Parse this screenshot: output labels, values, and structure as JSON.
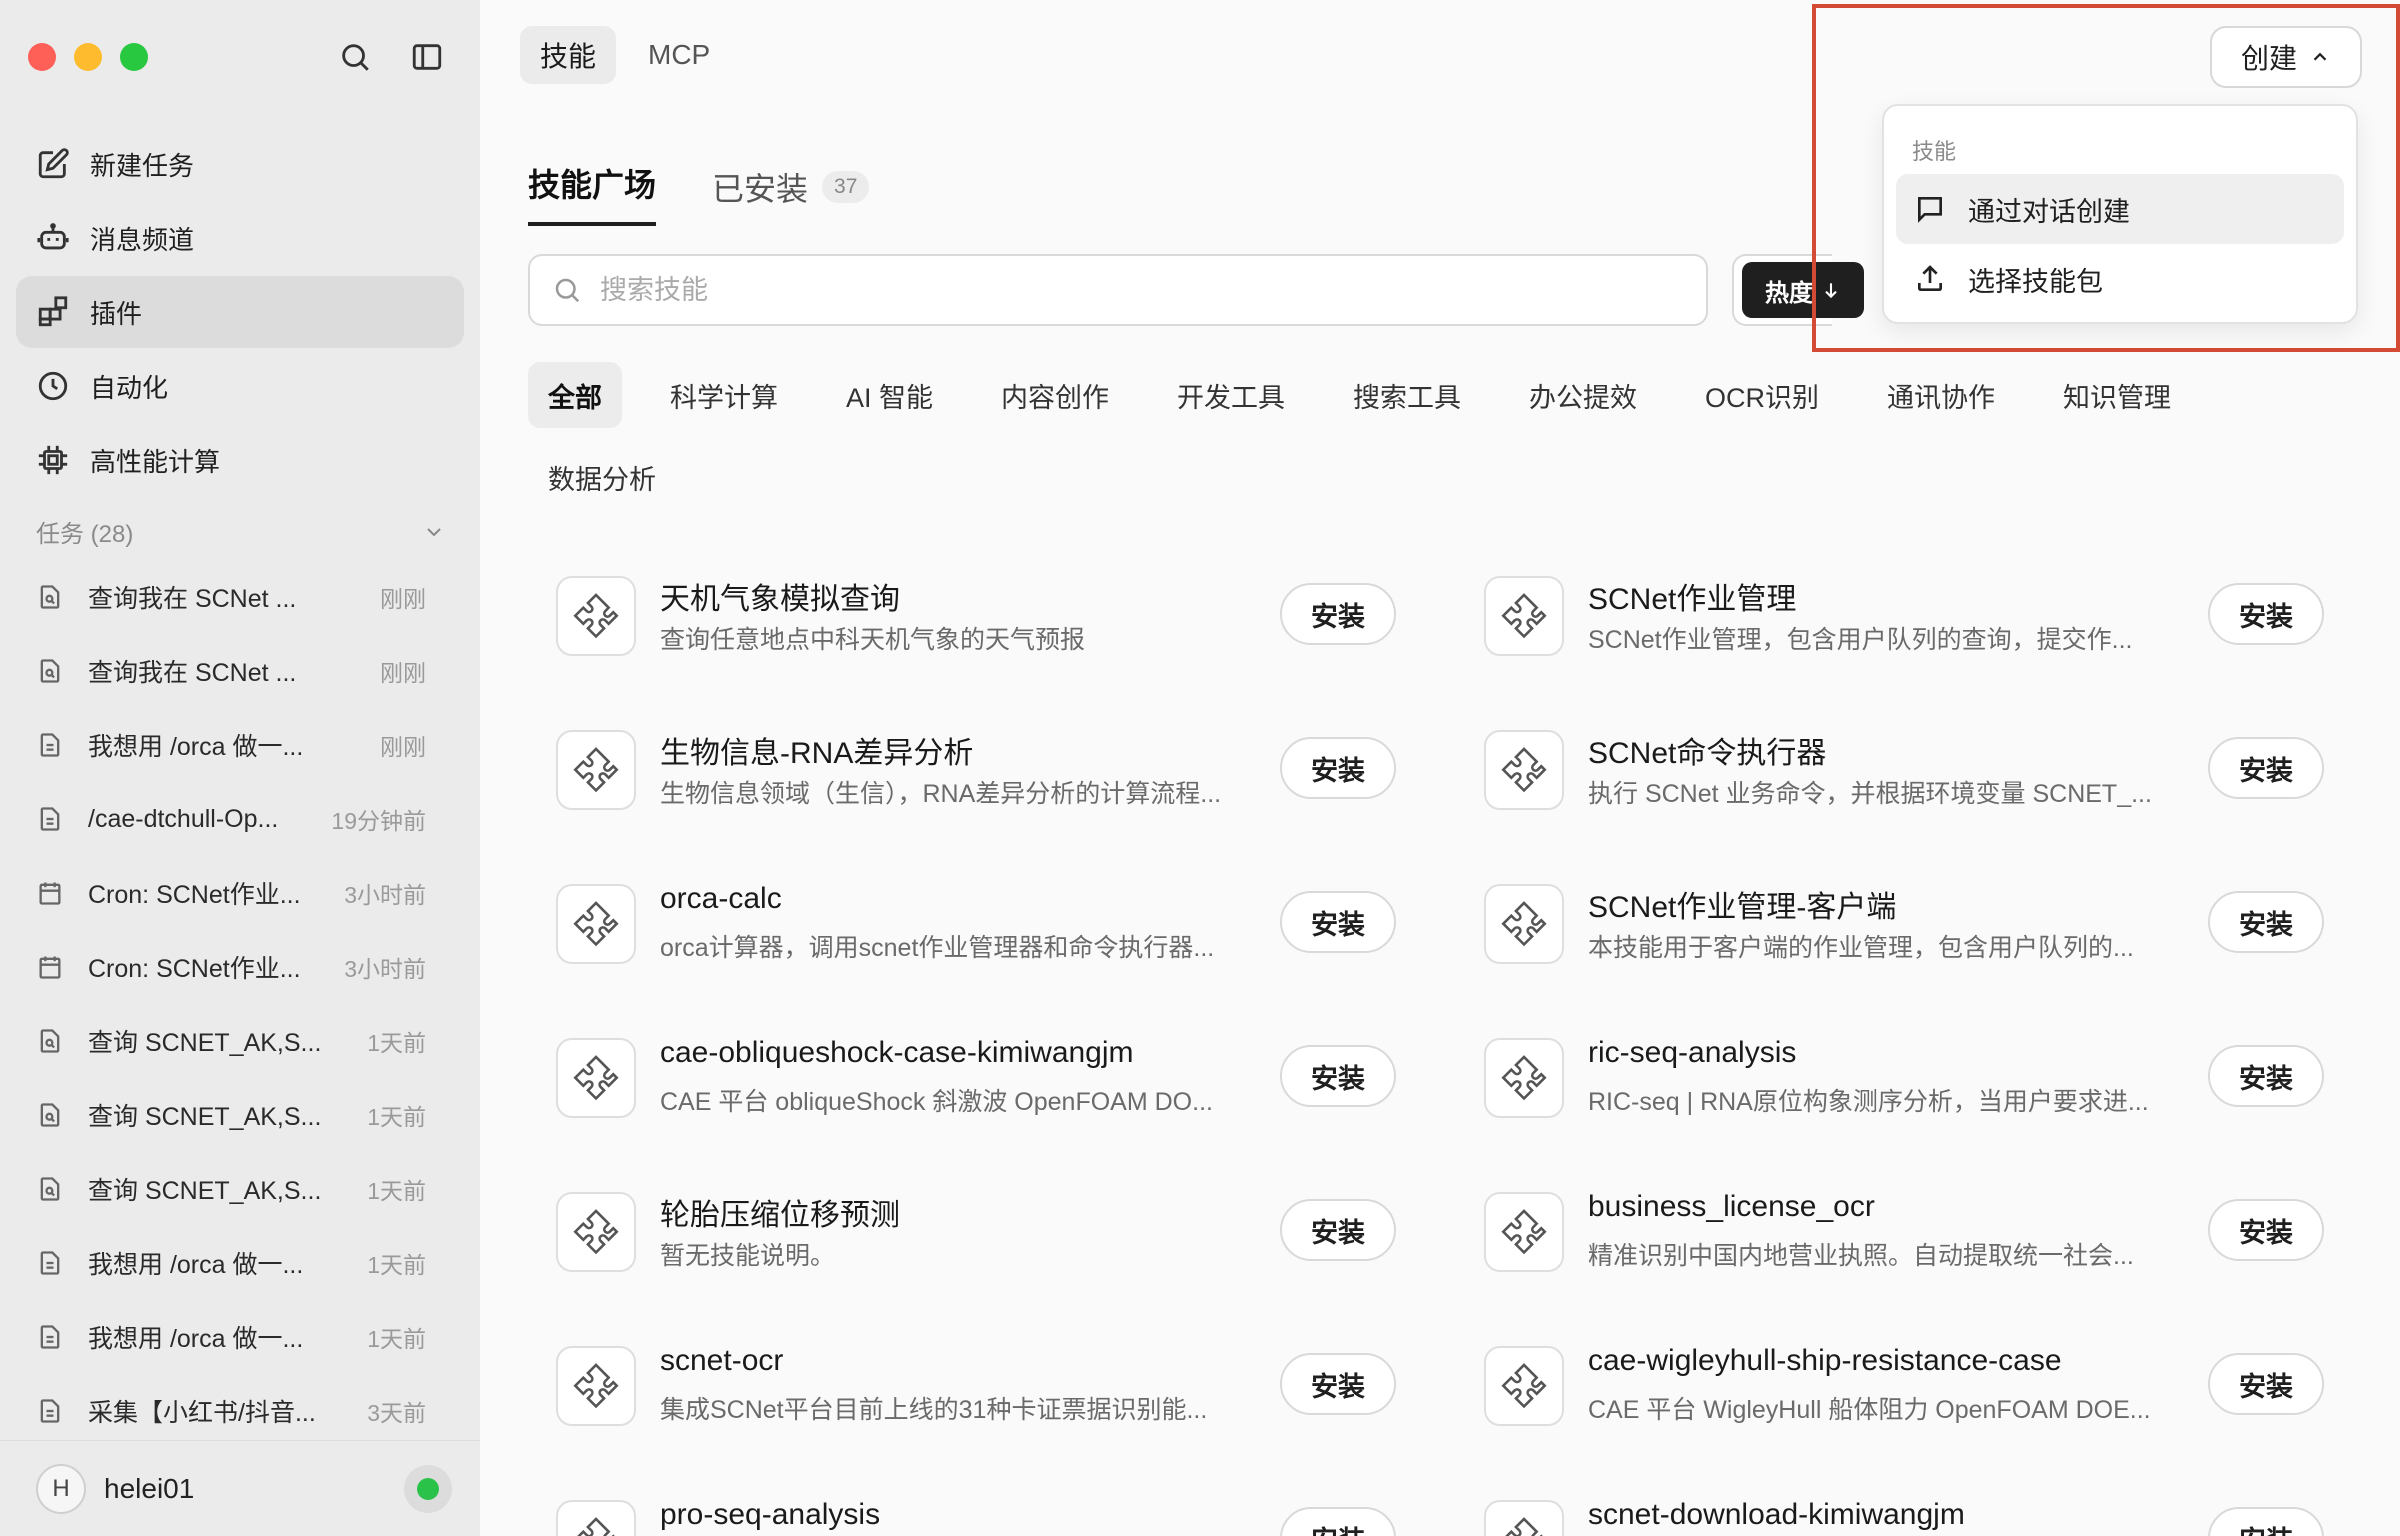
{
  "sidebar": {
    "nav": [
      {
        "label": "新建任务",
        "icon": "edit-icon"
      },
      {
        "label": "消息频道",
        "icon": "bot-icon"
      },
      {
        "label": "插件",
        "icon": "plugin-icon"
      },
      {
        "label": "自动化",
        "icon": "clock-icon"
      },
      {
        "label": "高性能计算",
        "icon": "chip-icon"
      }
    ],
    "tasks_header": "任务 (28)",
    "tasks": [
      {
        "title": "查询我在 SCNet ...",
        "time": "刚刚",
        "icon": "search-doc-icon"
      },
      {
        "title": "查询我在 SCNet ...",
        "time": "刚刚",
        "icon": "search-doc-icon"
      },
      {
        "title": "我想用 /orca 做一...",
        "time": "刚刚",
        "icon": "doc-icon"
      },
      {
        "title": "/cae-dtchull-Op...",
        "time": "19分钟前",
        "icon": "doc-icon"
      },
      {
        "title": "Cron: SCNet作业...",
        "time": "3小时前",
        "icon": "calendar-icon"
      },
      {
        "title": "Cron: SCNet作业...",
        "time": "3小时前",
        "icon": "calendar-icon"
      },
      {
        "title": "查询 SCNET_AK,S...",
        "time": "1天前",
        "icon": "search-doc-icon"
      },
      {
        "title": "查询 SCNET_AK,S...",
        "time": "1天前",
        "icon": "search-doc-icon"
      },
      {
        "title": "查询 SCNET_AK,S...",
        "time": "1天前",
        "icon": "search-doc-icon"
      },
      {
        "title": "我想用 /orca 做一...",
        "time": "1天前",
        "icon": "doc-icon"
      },
      {
        "title": "我想用 /orca 做一...",
        "time": "1天前",
        "icon": "doc-icon"
      },
      {
        "title": "采集【小红书/抖音...",
        "time": "3天前",
        "icon": "doc-icon"
      }
    ],
    "user": {
      "initial": "H",
      "name": "helei01",
      "status_color": "#2bc24a"
    }
  },
  "header": {
    "tabs": [
      "技能",
      "MCP"
    ],
    "create_label": "创建"
  },
  "subtabs": {
    "market": "技能广场",
    "installed": "已安装",
    "installed_count": "37"
  },
  "search": {
    "placeholder": "搜索技能",
    "value": ""
  },
  "sort": {
    "label": "热度"
  },
  "categories": [
    "全部",
    "科学计算",
    "AI 智能",
    "内容创作",
    "开发工具",
    "搜索工具",
    "办公提效",
    "OCR识别",
    "通讯协作",
    "知识管理",
    "数据分析"
  ],
  "install_label": "安装",
  "skills": [
    {
      "name": "天机气象模拟查询",
      "desc": "查询任意地点中科天机气象的天气预报"
    },
    {
      "name": "SCNet作业管理",
      "desc": "SCNet作业管理，包含用户队列的查询，提交作..."
    },
    {
      "name": "生物信息-RNA差异分析",
      "desc": "生物信息领域（生信），RNA差异分析的计算流程..."
    },
    {
      "name": "SCNet命令执行器",
      "desc": "执行 SCNet 业务命令，并根据环境变量 SCNET_..."
    },
    {
      "name": "orca-calc",
      "desc": "orca计算器，调用scnet作业管理器和命令执行器..."
    },
    {
      "name": "SCNet作业管理-客户端",
      "desc": "本技能用于客户端的作业管理，包含用户队列的..."
    },
    {
      "name": "cae-obliqueshock-case-kimiwangjm",
      "desc": "CAE 平台 obliqueShock 斜激波 OpenFOAM DO..."
    },
    {
      "name": "ric-seq-analysis",
      "desc": "RIC-seq | RNA原位构象测序分析，当用户要求进..."
    },
    {
      "name": "轮胎压缩位移预测",
      "desc": "暂无技能说明。"
    },
    {
      "name": "business_license_ocr",
      "desc": "精准识别中国内地营业执照。自动提取统一社会..."
    },
    {
      "name": "scnet-ocr",
      "desc": "集成SCNet平台目前上线的31种卡证票据识别能..."
    },
    {
      "name": "cae-wigleyhull-ship-resistance-case",
      "desc": "CAE 平台 WigleyHull 船体阻力 OpenFOAM DOE..."
    },
    {
      "name": "pro-seq-analysis",
      "desc": ""
    },
    {
      "name": "scnet-download-kimiwangjm",
      "desc": ""
    }
  ],
  "dropdown": {
    "section": "技能",
    "items": [
      "通过对话创建",
      "选择技能包"
    ]
  },
  "colors": {
    "accent_dark": "#1f1f1f",
    "highlight": "#d34b35",
    "status": "#2bc24a"
  }
}
